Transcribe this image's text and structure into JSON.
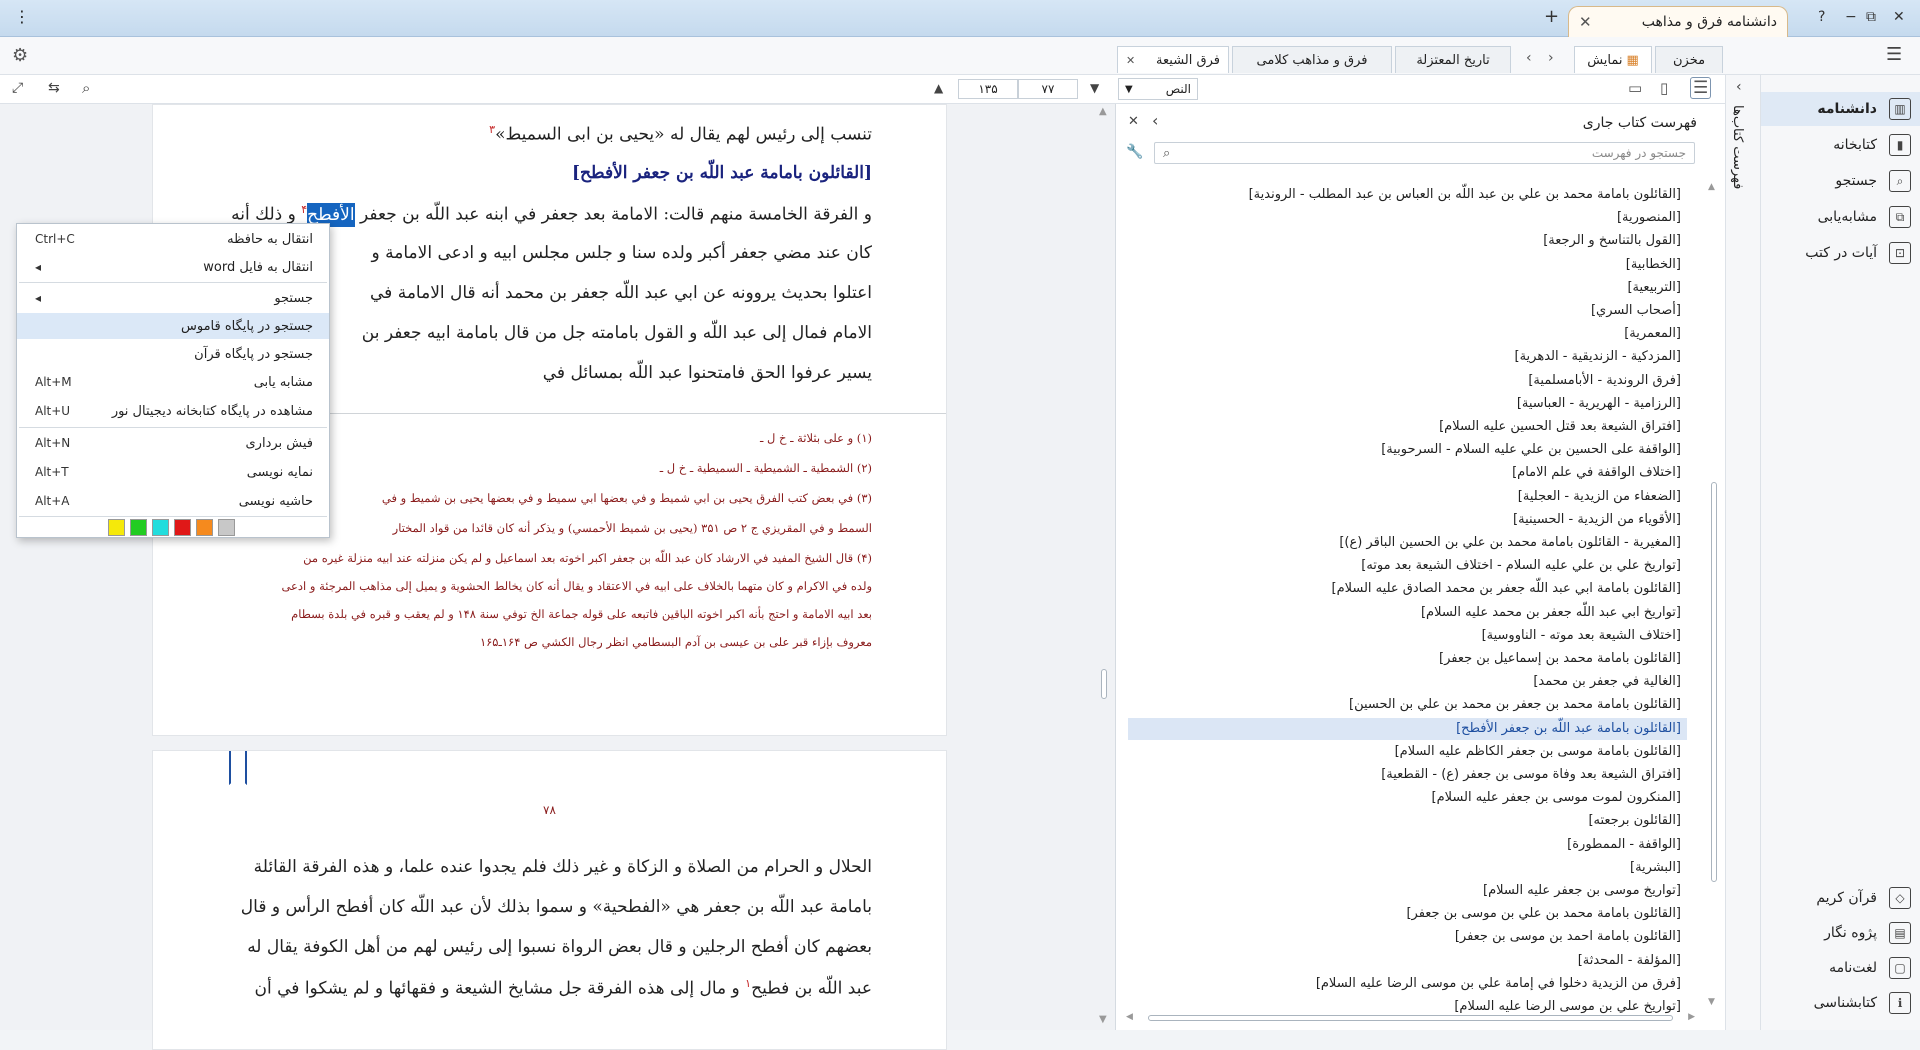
{
  "titlebar": {
    "app_title": "دانشنامه فرق و مذاهب",
    "close": "✕",
    "new_tab": "+",
    "menu": "⋮",
    "help": "?",
    "restore": "⧉",
    "minimize": "−",
    "close_window": "✕"
  },
  "toolbar": {
    "tab_store": "مخزن",
    "tab_display": "نمایش",
    "tabs": [
      "تاریخ المعتزلة",
      "فرق و مذاهب کلامی",
      "فرق الشیعة"
    ]
  },
  "navbar": {
    "mode": "النص",
    "page_current": "۷۷",
    "page_total": "۱۳۵"
  },
  "page1": {
    "line1": "تنسب إلی رئیس لهم یقال له «یحیی بن ابی السمیط»",
    "line1_ref": "۳",
    "heading": "[القائلون بامامة عبد اللّه بن جعفر الأفطح]",
    "line2a": "و الفرقة الخامسة منهم قالت: الامامة بعد جعفر في ابنه عبد اللّه بن جعفر",
    "line2_sel": "الأفطح",
    "line2_ref": "۴",
    "line2b": "و ذلك أنه",
    "line3": "كان عند مضي جعفر أكبر ولده سنا و جلس مجلس ابيه و ادعی الامامة و",
    "line4": "اعتلوا بحديث يروونه عن ابي عبد اللّه جعفر بن محمد أنه قال الامامة في",
    "line5": "الامام فمال إلی عبد اللّه و القول بامامته جل من قال بامامة ابيه جعفر بن",
    "line6": "يسير عرفوا الحق فامتحنوا عبد اللّه بمسائل في",
    "fn1": "(۱) و علی بثلاثة ـ خ ل ـ",
    "fn2": "(۲) الشمطية ـ الشميطية ـ السميطية ـ خ ل ـ",
    "fn3a": "(۳) في بعض كتب الفرق يحيی بن ابي شميط و في بعضها ابي سميط و في بعضها يحيی بن شميط و في",
    "fn3b": "السمط و في المقريزي ج ۲ ص ۳۵۱ (يحيی بن شميط الأحمسي) و يذكر أنه كان قائدا من قواد المختار",
    "fn4a": "(۴) قال الشيخ المفيد في الارشاد كان عبد اللّه بن جعفر اكبر اخوته بعد اسماعيل و لم يكن منزلته عند ابيه منزلة غيره من",
    "fn4b": "ولده في الاكرام و كان متهما بالخلاف علی ابيه في الاعتقاد و يقال أنه كان يخالط الحشوية و يميل إلی مذاهب المرجئة و ادعی",
    "fn4c": "بعد ابيه الامامة و احتج بأنه اكبر اخوته الباقين فاتبعه علی قوله جماعة الخ توفي سنة ۱۴۸ و لم يعقب و قبره في بلدة بسطام",
    "fn4d": "معروف بإزاء قبر علی بن عيسی بن آدم البسطامي انظر رجال الكشي ص ۱۶۴ـ۱۶۵"
  },
  "page2": {
    "page_no": "۷۸",
    "line1": "الحلال و الحرام من الصلاة و الزكاة و غير ذلك فلم يجدوا عنده علما، و هذه الفرقة القائلة",
    "line2": "بامامة عبد اللّه بن جعفر هي «الفطحية» و سموا بذلك لأن عبد اللّه كان أفطح الرأس و قال",
    "line3": "بعضهم كان أفطح الرجلين و قال بعض الرواة نسبوا إلی رئيس لهم من أهل الكوفة يقال له",
    "line4": "عبد اللّه بن فطيح",
    "line4_ref": "۱",
    "line4b": "و مال إلی هذه الفرقة جل مشايخ الشيعة و فقهائها و لم يشكوا في أن"
  },
  "context_menu": {
    "copy": "انتقال به حافظه",
    "copy_sc": "Ctrl+C",
    "to_word": "انتقال به فایل word",
    "search": "جستجو",
    "search_dict": "جستجو در پایگاه قاموس",
    "search_quran": "جستجو در پایگاه قرآن",
    "similar": "مشابه یابی",
    "similar_sc": "Alt+M",
    "noor_view": "مشاهده در پایگاه کتابخانه دیجیتال نور",
    "noor_sc": "Alt+U",
    "note": "فیش برداری",
    "note_sc": "Alt+N",
    "index": "نمایه نویسی",
    "index_sc": "Alt+T",
    "margin": "حاشیه نویسی",
    "margin_sc": "Alt+A",
    "colors": [
      "#f5e90a",
      "#22cc22",
      "#22dddd",
      "#e01818",
      "#f58a1e",
      "#c8c8c8"
    ]
  },
  "toc": {
    "title": "فهرست کتاب جاری",
    "search_placeholder": "جستجو در فهرست",
    "items": [
      "[القائلون بامامة محمد بن علي بن عبد اللّه بن العباس بن عبد المطلب - الروندية]",
      "[المنصورية]",
      "[القول بالتناسخ و الرجعة]",
      "[الخطابية]",
      "[التربيعية]",
      "[أصحاب السري]",
      "[المعمرية]",
      "[المزدكية - الزنديقية - الدهرية]",
      "[فرق الروندية - الأبامسلمية]",
      "[الرزامية - الهريرية - العباسية]",
      "[افتراق الشيعة بعد قتل الحسين عليه السلام]",
      "[الواقفة علی الحسين بن علي عليه السلام - السرحوبية]",
      "[اختلاف الواقفة في علم الامام]",
      "[الضعفاء من الزيدية - العجلية]",
      "[الأقوياء من الزيدية - الحسينية]",
      "[المغيرية - القائلون بامامة محمد بن علي بن الحسين الباقر (ع)]",
      "[تواريخ علي بن علي عليه السلام - اختلاف الشيعة بعد موته]",
      "[القائلون بامامة ابي عبد اللّه جعفر بن محمد الصادق عليه السلام]",
      "[تواريخ ابي عبد اللّه جعفر بن محمد عليه السلام]",
      "[اختلاف الشيعة بعد موته - الناووسية]",
      "[القائلون بامامة محمد بن إسماعيل بن جعفر]",
      "[الغالية في جعفر بن محمد]",
      "[القائلون بامامة محمد بن جعفر بن محمد بن علي بن الحسين]",
      "[القائلون بامامة عبد اللّه بن جعفر الأفطح]",
      "[القائلون بامامة موسی بن جعفر الكاظم عليه السلام]",
      "[افتراق الشيعة بعد وفاة موسی بن جعفر (ع) - القطعية]",
      "[المنكرون لموت موسی بن جعفر عليه السلام]",
      "[القائلون برجعته]",
      "[الواقفة - الممطورة]",
      "[البشرية]",
      "[تواريخ موسی بن جعفر عليه السلام]",
      "[القائلون بامامة محمد بن علي بن موسی بن جعفر]",
      "[القائلون بامامة احمد بن موسی بن جعفر]",
      "[المؤلفة - المحدثة]",
      "[فرق من الزيدية دخلوا في إمامة علي بن موسی الرضا عليه السلام]",
      "[تواريخ علي بن موسی الرضا عليه السلام]"
    ]
  },
  "vstrip": {
    "label": "فهرست کتاب‌ها"
  },
  "sidebar": {
    "items": [
      {
        "label": "دانشنامه",
        "icon": "▥"
      },
      {
        "label": "کتابخانه",
        "icon": "▮"
      },
      {
        "label": "جستجو",
        "icon": "⌕"
      },
      {
        "label": "مشابه‌یابی",
        "icon": "⧉"
      },
      {
        "label": "آیات در کتب",
        "icon": "⊡"
      }
    ],
    "bottom": [
      {
        "label": "قرآن کریم",
        "icon": "◇"
      },
      {
        "label": "پژوه نگار",
        "icon": "▤"
      },
      {
        "label": "لغت‌نامه",
        "icon": "▢"
      },
      {
        "label": "کتابشناسی",
        "icon": "ℹ"
      }
    ]
  }
}
